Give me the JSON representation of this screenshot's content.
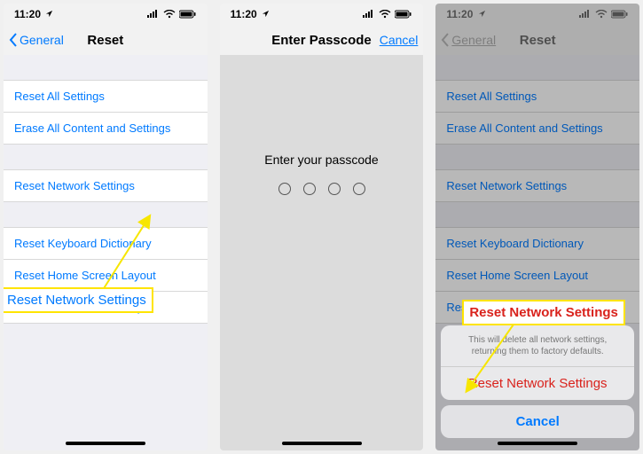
{
  "status": {
    "time": "11:20",
    "location_icon": "location-arrow-icon"
  },
  "screen1": {
    "nav_back": "General",
    "nav_title": "Reset",
    "items": [
      "Reset All Settings",
      "Erase All Content and Settings",
      "Reset Network Settings",
      "Reset Keyboard Dictionary",
      "Reset Home Screen Layout",
      "Reset Location & Privacy"
    ],
    "callout": "Reset Network Settings"
  },
  "screen2": {
    "nav_title": "Enter Passcode",
    "nav_cancel": "Cancel",
    "prompt": "Enter your passcode"
  },
  "screen3": {
    "nav_back": "General",
    "nav_title": "Reset",
    "items": [
      "Reset All Settings",
      "Erase All Content and Settings",
      "Reset Network Settings",
      "Reset Keyboard Dictionary",
      "Reset Home Screen Layout",
      "Reset Location & Privacy"
    ],
    "callout": "Reset Network Settings",
    "sheet": {
      "message": "This will delete all network settings, returning them to factory defaults.",
      "action": "Reset Network Settings",
      "cancel": "Cancel"
    }
  }
}
